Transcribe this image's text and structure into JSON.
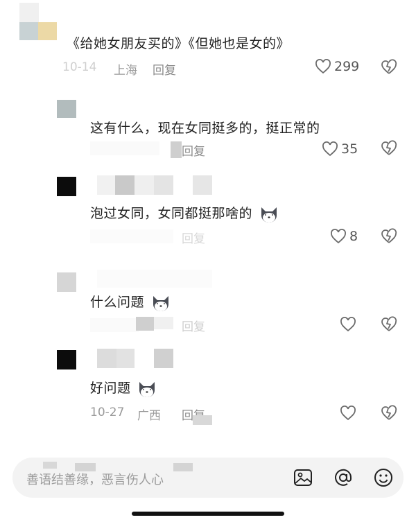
{
  "comments": [
    {
      "text": "《给她女朋友买的》《但她也是女的》",
      "meta_time": "10-14",
      "meta_location": "上海",
      "reply_label": "回复",
      "likes": "299"
    },
    {
      "text": "这有什么，现在女同挺多的，挺正常的",
      "reply_label": "回复",
      "likes": "35"
    },
    {
      "text": "泡过女同，女同都挺那啥的",
      "reply_label": "回复",
      "likes": "8"
    },
    {
      "text": "什么问题",
      "reply_label": "回复",
      "likes": ""
    },
    {
      "text": "好问题",
      "meta_time": "10-27",
      "meta_location": "广西",
      "reply_label": "回复",
      "likes": ""
    }
  ],
  "input": {
    "placeholder": "善语结善缘，恶言伤人心"
  },
  "colors": {
    "heart_outline": "#6b6b6b",
    "input_bg": "#f3f3f3"
  },
  "icons": [
    "heart-icon",
    "broken-heart-icon",
    "image-icon",
    "at-icon",
    "emoji-icon",
    "dog-emoji"
  ]
}
